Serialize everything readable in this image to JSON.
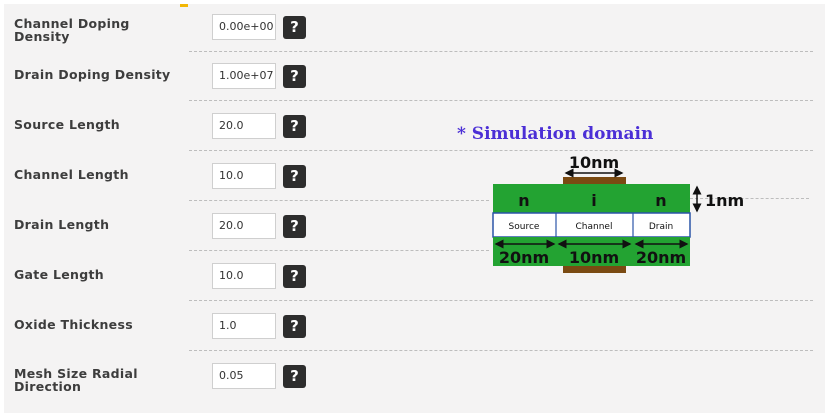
{
  "help_label": "?",
  "fields": [
    {
      "label": "Channel Doping Density",
      "value": "0.00e+00"
    },
    {
      "label": "Drain Doping Density",
      "value": "1.00e+07"
    },
    {
      "label": "Source Length",
      "value": "20.0"
    },
    {
      "label": "Channel Length",
      "value": "10.0"
    },
    {
      "label": "Drain Length",
      "value": "20.0"
    },
    {
      "label": "Gate Length",
      "value": "10.0"
    },
    {
      "label": "Oxide Thickness",
      "value": "1.0"
    },
    {
      "label": "Mesh Size Radial Direction",
      "value": "0.05"
    }
  ],
  "diagram": {
    "title": "* Simulation domain",
    "gate_length_label": "10nm",
    "thickness_label": "1nm",
    "top_regions": [
      "n",
      "i",
      "n"
    ],
    "mid_regions": [
      "Source",
      "Channel",
      "Drain"
    ],
    "bottom_labels": [
      "20nm",
      "10nm",
      "20nm"
    ],
    "colors": {
      "region": "#23a332",
      "gate": "#7a4a12",
      "title": "#4b2fd6"
    }
  }
}
